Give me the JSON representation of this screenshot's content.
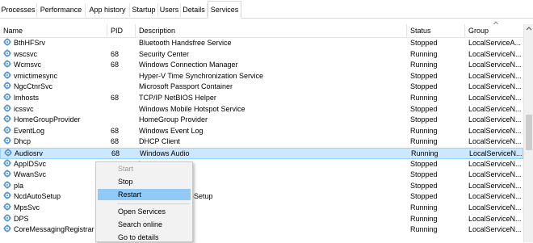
{
  "tabs": [
    {
      "label": "Processes"
    },
    {
      "label": "Performance"
    },
    {
      "label": "App history"
    },
    {
      "label": "Startup"
    },
    {
      "label": "Users"
    },
    {
      "label": "Details"
    },
    {
      "label": "Services"
    }
  ],
  "active_tab": "Services",
  "columns": {
    "name": "Name",
    "pid": "PID",
    "description": "Description",
    "status": "Status",
    "group": "Group"
  },
  "sort": {
    "column": "group",
    "direction": "ascending"
  },
  "services": [
    {
      "name": "BthHFSrv",
      "pid": "",
      "description": "Bluetooth Handsfree Service",
      "status": "Stopped",
      "group": "LocalServiceA..."
    },
    {
      "name": "wscsvc",
      "pid": "68",
      "description": "Security Center",
      "status": "Running",
      "group": "LocalServiceN..."
    },
    {
      "name": "Wcmsvc",
      "pid": "68",
      "description": "Windows Connection Manager",
      "status": "Running",
      "group": "LocalServiceN..."
    },
    {
      "name": "vmictimesync",
      "pid": "",
      "description": "Hyper-V Time Synchronization Service",
      "status": "Stopped",
      "group": "LocalServiceN..."
    },
    {
      "name": "NgcCtnrSvc",
      "pid": "",
      "description": "Microsoft Passport Container",
      "status": "Stopped",
      "group": "LocalServiceN..."
    },
    {
      "name": "lmhosts",
      "pid": "68",
      "description": "TCP/IP NetBIOS Helper",
      "status": "Running",
      "group": "LocalServiceN..."
    },
    {
      "name": "icssvc",
      "pid": "",
      "description": "Windows Mobile Hotspot Service",
      "status": "Stopped",
      "group": "LocalServiceN..."
    },
    {
      "name": "HomeGroupProvider",
      "pid": "",
      "description": "HomeGroup Provider",
      "status": "Stopped",
      "group": "LocalServiceN..."
    },
    {
      "name": "EventLog",
      "pid": "68",
      "description": "Windows Event Log",
      "status": "Running",
      "group": "LocalServiceN..."
    },
    {
      "name": "Dhcp",
      "pid": "68",
      "description": "DHCP Client",
      "status": "Running",
      "group": "LocalServiceN..."
    },
    {
      "name": "Audiosrv",
      "pid": "68",
      "description": "Windows Audio",
      "status": "Running",
      "group": "LocalServiceN...",
      "selected": true
    },
    {
      "name": "AppIDSvc",
      "pid": "",
      "description": "ity",
      "status": "Stopped",
      "group": "LocalServiceN..."
    },
    {
      "name": "WwanSvc",
      "pid": "",
      "description": "",
      "status": "Stopped",
      "group": "LocalServiceN..."
    },
    {
      "name": "pla",
      "pid": "",
      "description": "s & Alerts",
      "status": "Stopped",
      "group": "LocalServiceN..."
    },
    {
      "name": "NcdAutoSetup",
      "pid": "",
      "description": "ed Devices Auto-Setup",
      "status": "Stopped",
      "group": "LocalServiceN..."
    },
    {
      "name": "MpsSvc",
      "pid": "",
      "description": "",
      "status": "Running",
      "group": "LocalServiceN..."
    },
    {
      "name": "DPS",
      "pid": "",
      "description": "Service",
      "status": "Running",
      "group": "LocalServiceN..."
    },
    {
      "name": "CoreMessagingRegistrar",
      "pid": "",
      "description": "",
      "status": "Running",
      "group": "LocalServiceN..."
    }
  ],
  "context_menu": {
    "items": [
      {
        "label": "Start",
        "disabled": true
      },
      {
        "label": "Stop"
      },
      {
        "label": "Restart",
        "highlighted": true
      },
      {
        "label": "Open Services"
      },
      {
        "label": "Search online"
      },
      {
        "label": "Go to details"
      }
    ]
  },
  "colors": {
    "selection": "#cce8ff",
    "menu_highlight": "#91c9f7",
    "icon_blue": "#4a8fd1"
  }
}
